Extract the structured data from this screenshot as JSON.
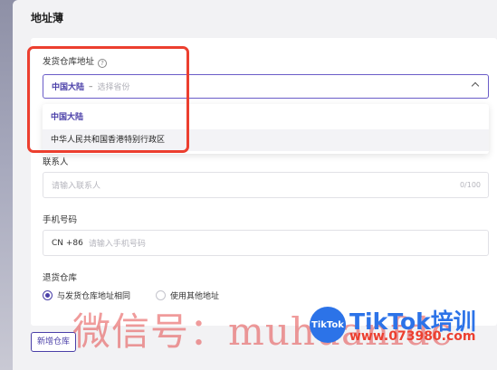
{
  "panel": {
    "title": "地址薄"
  },
  "shipping": {
    "label": "发货仓库地址",
    "help_icon": "help-circle-icon",
    "selected_value": "中国大陆",
    "separator": "–",
    "placeholder": "选择省份",
    "options": [
      "中国大陆",
      "中华人民共和国香港特别行政区"
    ]
  },
  "contact": {
    "label": "联系人",
    "placeholder": "请输入联系人",
    "counter": "0/100"
  },
  "phone": {
    "label": "手机号码",
    "prefix": "CN +86",
    "placeholder": "请输入手机号码"
  },
  "returns": {
    "label": "退货仓库",
    "options": [
      {
        "label": "与发货仓库地址相同",
        "selected": true
      },
      {
        "label": "使用其他地址",
        "selected": false
      }
    ]
  },
  "add_button": "新增仓库",
  "watermark": {
    "text": "微信号：muhuanfdc",
    "logo": "TikTok",
    "brand": "TikTok培训",
    "url": "www.073980.com"
  },
  "colors": {
    "accent": "#4a3fa8",
    "highlight": "#ec3f2f"
  }
}
